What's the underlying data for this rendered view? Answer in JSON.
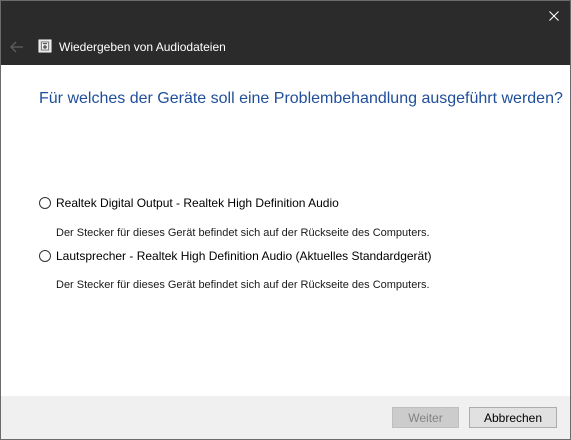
{
  "window": {
    "title": "Wiedergeben von Audiodateien",
    "close_glyph": "✕",
    "back_glyph": "←"
  },
  "main": {
    "heading": "Für welches der Geräte soll eine Problembehandlung ausgeführt werden?",
    "options": [
      {
        "label": "Realtek Digital Output - Realtek High Definition Audio",
        "description": "Der Stecker für dieses Gerät befindet sich auf der Rückseite des Computers.",
        "selected": false
      },
      {
        "label": "Lautsprecher - Realtek High Definition Audio (Aktuelles Standardgerät)",
        "description": "Der Stecker für dieses Gerät befindet sich auf der Rückseite des Computers.",
        "selected": false
      }
    ]
  },
  "footer": {
    "next_label": "Weiter",
    "cancel_label": "Abbrechen",
    "next_enabled": false
  },
  "colors": {
    "titlebar_bg": "#2b2b2b",
    "heading": "#1f4e9a",
    "footer_bg": "#f0f0f0"
  },
  "icons": {
    "back": "back-arrow-icon",
    "close": "close-icon",
    "app": "troubleshooter-app-icon"
  }
}
